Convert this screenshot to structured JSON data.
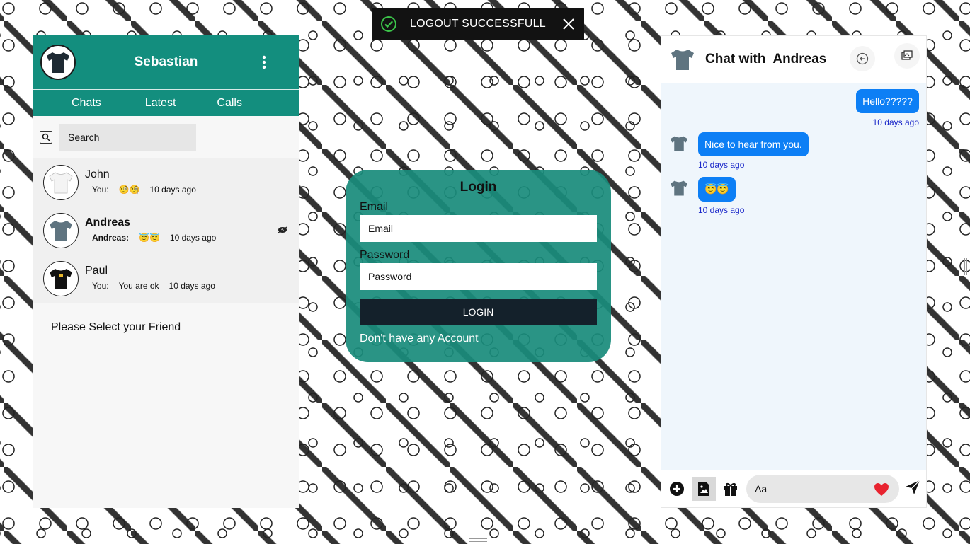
{
  "toast": {
    "message": "LOGOUT SUCCESSFULL",
    "icon": "check-circle-icon",
    "accent": "#3cc44a"
  },
  "left": {
    "username": "Sebastian",
    "tabs": [
      "Chats",
      "Latest",
      "Calls"
    ],
    "search": {
      "placeholder": "Search"
    },
    "friends": [
      {
        "name": "John",
        "who": "You:",
        "message": "🧐🧐",
        "time": "10 days ago",
        "shirt": "#f4f4f4"
      },
      {
        "name": "Andreas",
        "who": "Andreas:",
        "message": "😇😇",
        "time": "10 days ago",
        "shirt": "#5f7480"
      },
      {
        "name": "Paul",
        "who": "You:",
        "message": "You are ok",
        "time": "10 days ago",
        "shirt": "#111111"
      }
    ],
    "empty_message": "Please Select your Friend"
  },
  "login": {
    "title": "Login",
    "email_label": "Email",
    "email_placeholder": "Email",
    "password_label": "Password",
    "password_placeholder": "Password",
    "button": "LOGIN",
    "signup_link": "Don't have any Account"
  },
  "chat": {
    "title": "Chat with  Andreas",
    "messages": [
      {
        "direction": "out",
        "text": "Hello?????",
        "time": "10 days ago"
      },
      {
        "direction": "in",
        "text": "Nice to hear from you.",
        "time": "10 days ago"
      },
      {
        "direction": "in",
        "text": "😇😇",
        "time": "10 days ago"
      }
    ],
    "composer_placeholder": "Aa"
  },
  "colors": {
    "primary": "#138e7e",
    "bubble": "#0d7ff5",
    "timestamp": "#1a27c9",
    "login_button": "#14212b"
  }
}
